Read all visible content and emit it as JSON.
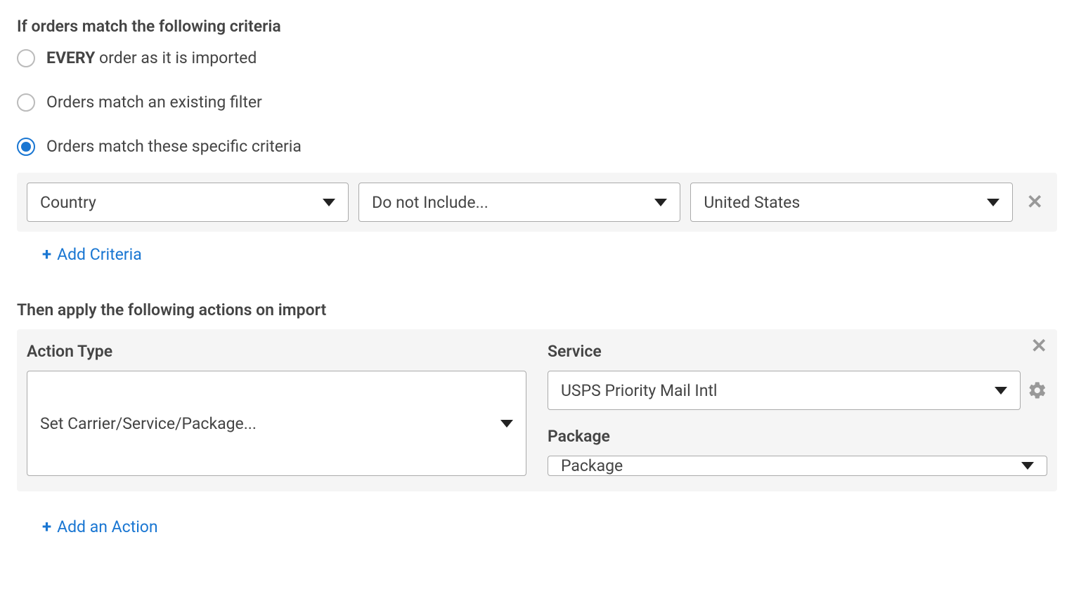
{
  "criteria": {
    "heading": "If orders match the following criteria",
    "options": {
      "every_bold": "EVERY",
      "every_rest": " order as it is imported",
      "existing_filter": "Orders match an existing filter",
      "specific": "Orders match these specific criteria"
    },
    "row": {
      "field": "Country",
      "operator": "Do not Include...",
      "value": "United States"
    },
    "add_label": "Add Criteria"
  },
  "actions": {
    "heading": "Then apply the following actions on import",
    "labels": {
      "action_type": "Action Type",
      "service": "Service",
      "package": "Package"
    },
    "values": {
      "action_type": "Set Carrier/Service/Package...",
      "service": "USPS Priority Mail Intl",
      "package": "Package"
    },
    "add_label": "Add an Action"
  }
}
